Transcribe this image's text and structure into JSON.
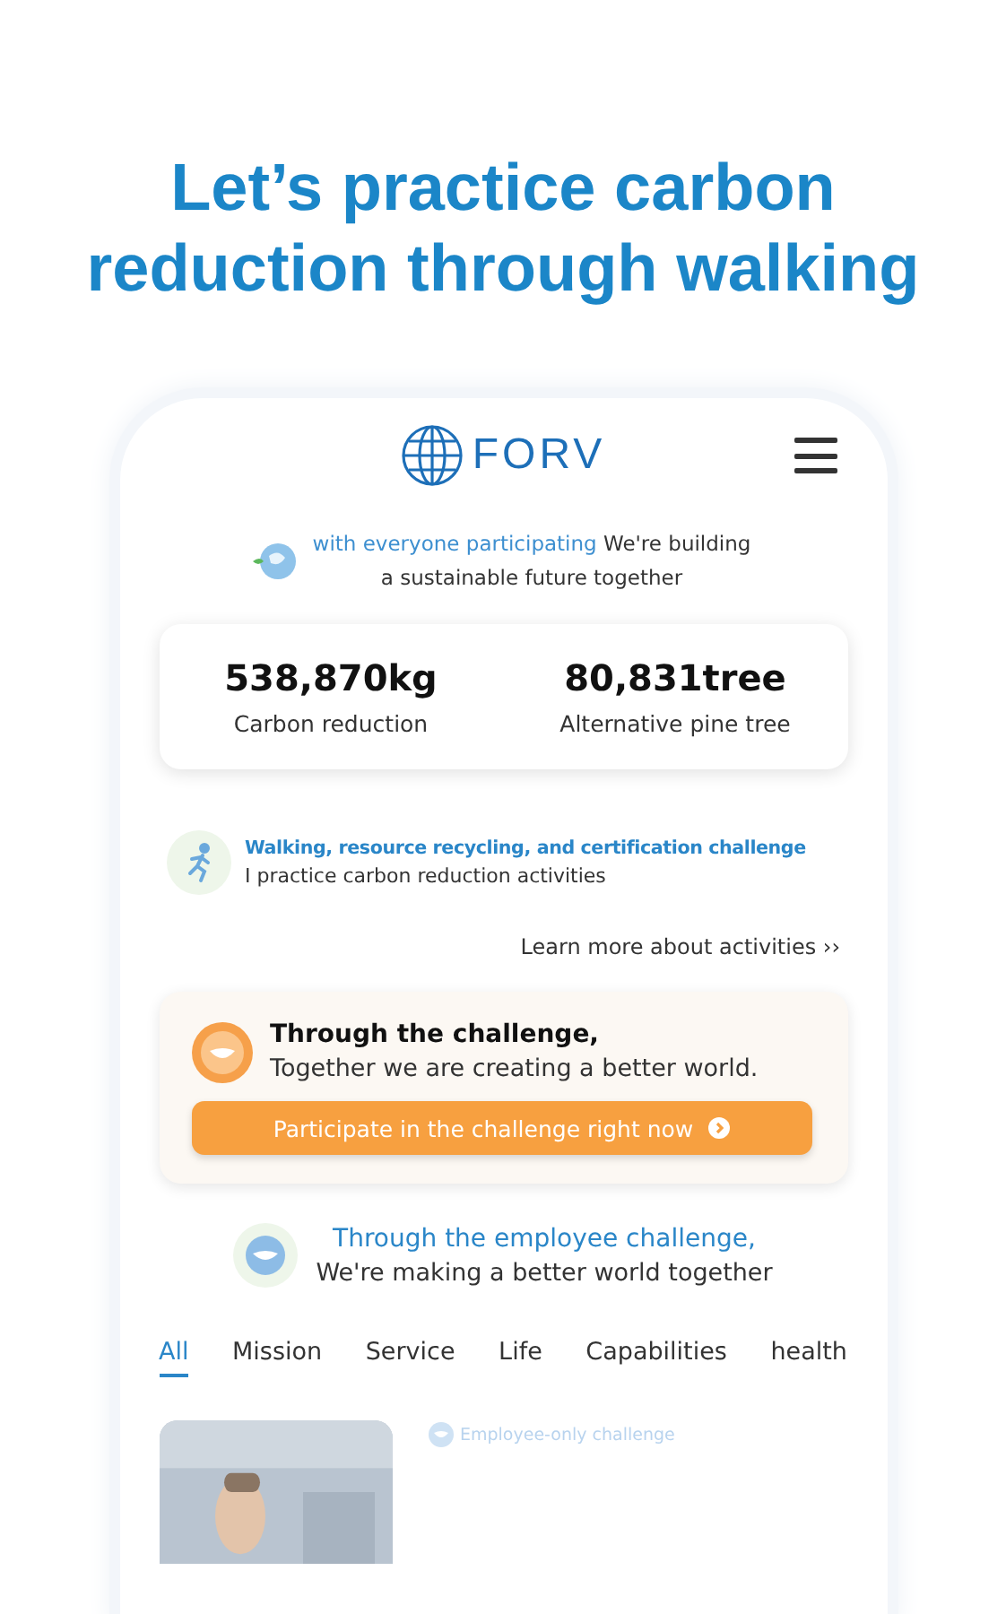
{
  "headline": "Let’s practice carbon reduction through walking",
  "header": {
    "logo": "FORV"
  },
  "intro": {
    "highlight": "with everyone participating",
    "text": "We're building a sustainable future together"
  },
  "stats": [
    {
      "value": "538,870kg",
      "label": "Carbon reduction"
    },
    {
      "value": "80,831tree",
      "label": "Alternative pine tree"
    }
  ],
  "challenge_info": {
    "title": "Walking, resource recycling, and certification challenge",
    "subtitle": "I practice carbon reduction activities"
  },
  "more_link": "Learn more about activities ››",
  "promo": {
    "title": "Through the challenge,",
    "subtitle": "Together we are creating a better world.",
    "button": "Participate in the challenge right now"
  },
  "employee": {
    "title": "Through the employee challenge,",
    "subtitle": "We're making a better world together"
  },
  "tabs": [
    {
      "label": "All",
      "selected": true
    },
    {
      "label": "Mission",
      "selected": false
    },
    {
      "label": "Service",
      "selected": false
    },
    {
      "label": "Life",
      "selected": false
    },
    {
      "label": "Capabilities",
      "selected": false
    },
    {
      "label": "health",
      "selected": false
    }
  ],
  "list_item": {
    "badge": "Employee-only challenge"
  }
}
